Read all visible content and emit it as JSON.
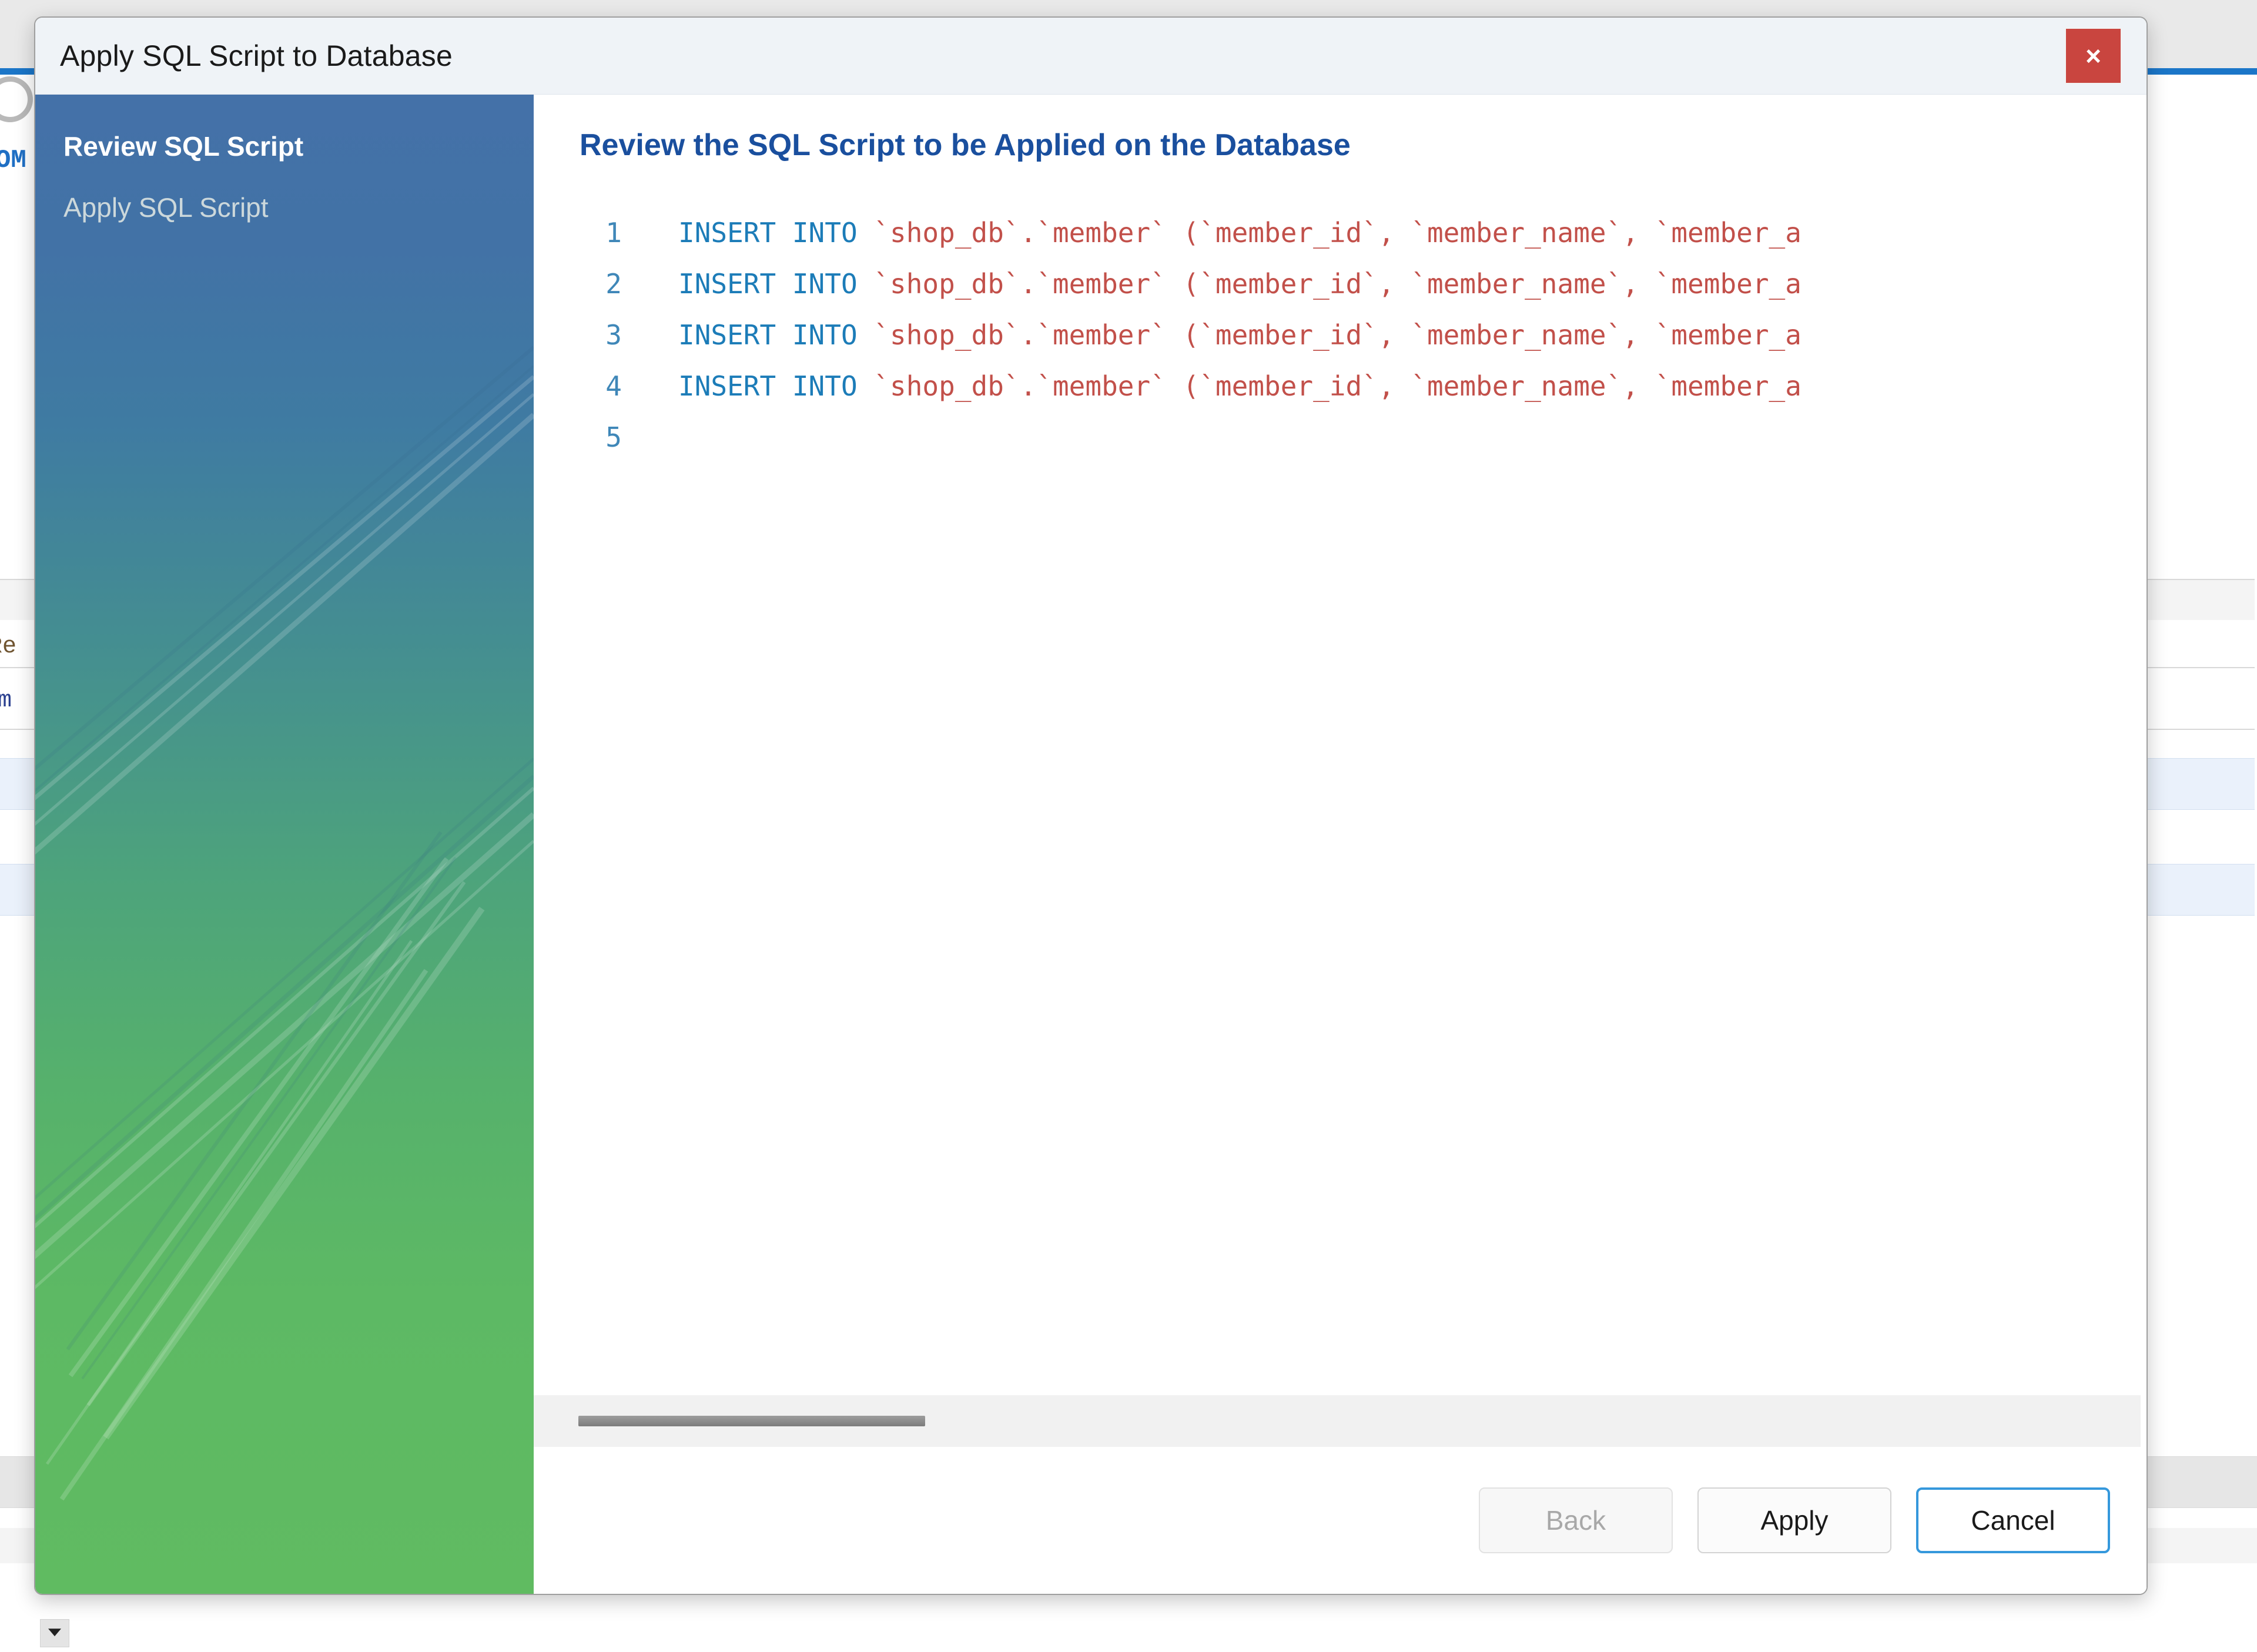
{
  "background": {
    "fragment_from": "OM",
    "fragment_re": "Re",
    "fragment_name": "am",
    "scroll_down_icon": "triangle-down-icon",
    "splitter_grip_icon": "dotted-grip-icon"
  },
  "dialog": {
    "title": "Apply SQL Script to Database",
    "close_label": "×",
    "sidebar": {
      "items": [
        {
          "label": "Review SQL Script",
          "state": "active"
        },
        {
          "label": "Apply SQL Script",
          "state": "inactive"
        }
      ]
    },
    "content": {
      "heading": "Review the SQL Script to be Applied on the Database",
      "code": {
        "lines": [
          {
            "number": "1",
            "segments": [
              {
                "text": "INSERT INTO ",
                "type": "keyword"
              },
              {
                "text": "`shop_db`.`member` (`member_id`, `member_name`, `member_a",
                "type": "identifier"
              }
            ]
          },
          {
            "number": "2",
            "segments": [
              {
                "text": "INSERT INTO ",
                "type": "keyword"
              },
              {
                "text": "`shop_db`.`member` (`member_id`, `member_name`, `member_a",
                "type": "identifier"
              }
            ]
          },
          {
            "number": "3",
            "segments": [
              {
                "text": "INSERT INTO ",
                "type": "keyword"
              },
              {
                "text": "`shop_db`.`member` (`member_id`, `member_name`, `member_a",
                "type": "identifier"
              }
            ]
          },
          {
            "number": "4",
            "segments": [
              {
                "text": "INSERT INTO ",
                "type": "keyword"
              },
              {
                "text": "`shop_db`.`member` (`member_id`, `member_name`, `member_a",
                "type": "identifier"
              }
            ]
          },
          {
            "number": "5",
            "segments": []
          }
        ]
      },
      "scrollbar": {
        "orientation": "horizontal"
      }
    },
    "footer": {
      "buttons": [
        {
          "label": "Back",
          "state": "disabled"
        },
        {
          "label": "Apply",
          "state": "normal"
        },
        {
          "label": "Cancel",
          "state": "focused"
        }
      ]
    }
  },
  "colors": {
    "titlebar_bg": "#eff3f7",
    "close_red": "#c9453f",
    "heading_blue": "#1a4f9e",
    "sidebar_top": "#4471a8",
    "sidebar_bottom": "#60bb61",
    "sql_keyword": "#1c7cb8",
    "sql_identifier": "#c2504a",
    "line_number": "#3f87b8",
    "focus_ring": "#3598dc",
    "tab_underline": "#1b76c8"
  }
}
